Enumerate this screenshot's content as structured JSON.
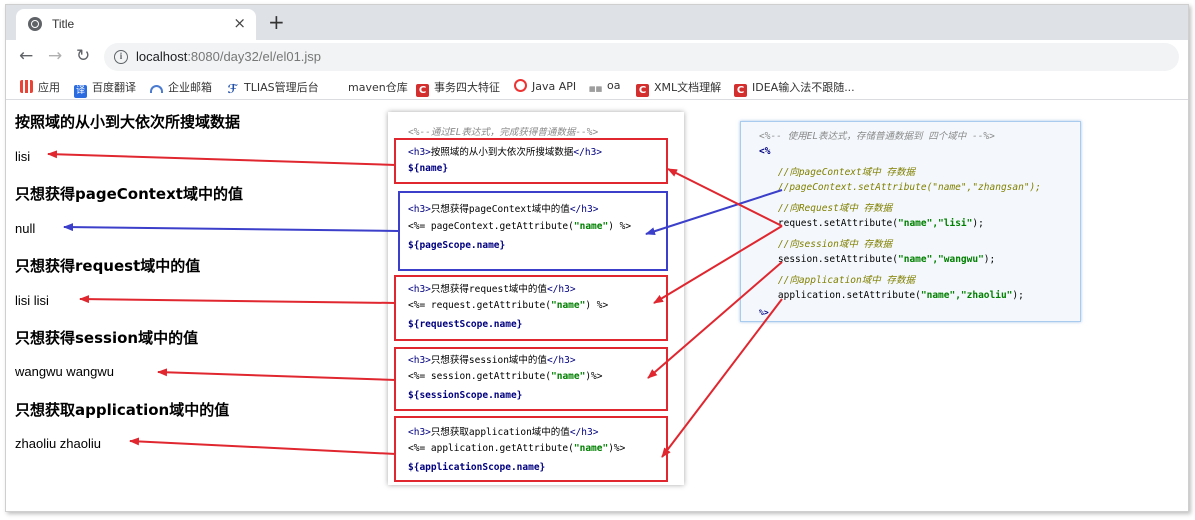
{
  "browser": {
    "tab_title": "Title",
    "tab_close": "×",
    "new_tab": "+",
    "url_host": "localhost",
    "url_rest": ":8080/day32/el/el01.jsp",
    "bookmarks": [
      "应用",
      "百度翻译",
      "企业邮箱",
      "TLIAS管理后台",
      "maven仓库",
      "事务四大特征",
      "Java API",
      "oa",
      "XML文档理解",
      "IDEA输入法不跟随..."
    ]
  },
  "page": {
    "headings": [
      "按照域的从小到大依次所搜域数据",
      "只想获得pageContext域中的值",
      "只想获得request域中的值",
      "只想获得session域中的值",
      "只想获取application域中的值"
    ],
    "values": [
      "lisi",
      "null",
      "lisi lisi",
      "wangwu wangwu",
      "zhaoliu zhaoliu"
    ]
  },
  "code_left": {
    "top_comment": "<%--通过EL表达式，完成获得普通数据--%>",
    "blocks": [
      {
        "h3_open": "<h3>",
        "h3_text": "按照域的从小到大依次所搜域数据",
        "h3_close": "</h3>",
        "line2_pre": "",
        "line2_str": "",
        "line2_post": "",
        "el": "${name}"
      },
      {
        "h3_open": "<h3>",
        "h3_text": "只想获得pageContext域中的值",
        "h3_close": "</h3>",
        "line2_pre": "<%= pageContext.getAttribute(",
        "line2_str": "\"name\"",
        "line2_post": ") %>",
        "el": "${pageScope.name}"
      },
      {
        "h3_open": "<h3>",
        "h3_text": "只想获得request域中的值",
        "h3_close": "</h3>",
        "line2_pre": "<%= request.getAttribute(",
        "line2_str": "\"name\"",
        "line2_post": ") %>",
        "el": "${requestScope.name}"
      },
      {
        "h3_open": "<h3>",
        "h3_text": "只想获得session域中的值",
        "h3_close": "</h3>",
        "line2_pre": "<%= session.getAttribute(",
        "line2_str": "\"name\"",
        "line2_post": ")%>",
        "el": "${sessionScope.name}"
      },
      {
        "h3_open": "<h3>",
        "h3_text": "只想获取application域中的值",
        "h3_close": "</h3>",
        "line2_pre": "<%= application.getAttribute(",
        "line2_str": "\"name\"",
        "line2_post": ")%>",
        "el": "${applicationScope.name}"
      }
    ]
  },
  "code_right": {
    "lines": [
      {
        "cls": "cmt",
        "text": "<%-- 使用EL表达式，存储普通数据到 四个域中 --%>"
      },
      {
        "cls": "dl",
        "text": "<%"
      },
      {
        "cls": "cmt2",
        "text": "    //向pageContext域中 存数据"
      },
      {
        "cls": "cmt2",
        "text": "    //pageContext.setAttribute(\"name\",\"zhangsan\");"
      },
      {
        "cls": "cmt2",
        "text": "    //向Request域中 存数据"
      },
      {
        "cls": "",
        "text": "    request.setAttribute(",
        "str": "\"name\",\"lisi\"",
        "post": ");"
      },
      {
        "cls": "cmt2",
        "text": "    //向session域中 存数据"
      },
      {
        "cls": "",
        "text": "    session.setAttribute(",
        "str": "\"name\",\"wangwu\"",
        "post": ");"
      },
      {
        "cls": "cmt2",
        "text": "    //向application域中 存数据"
      },
      {
        "cls": "",
        "text": "    application.setAttribute(",
        "str": "\"name\",\"zhaoliu\"",
        "post": ");"
      },
      {
        "cls": "dl",
        "text": "%>"
      }
    ]
  },
  "colors": {
    "red_arrow": "#e0262f",
    "blue_arrow": "#3b3fc9"
  }
}
